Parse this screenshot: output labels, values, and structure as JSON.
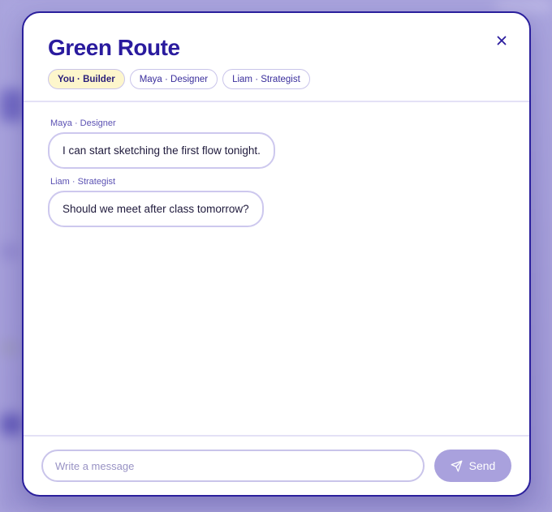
{
  "chat": {
    "title": "Green Route",
    "participants": [
      {
        "label": "You · Builder",
        "active": true
      },
      {
        "label": "Maya · Designer",
        "active": false
      },
      {
        "label": "Liam · Strategist",
        "active": false
      }
    ],
    "messages": [
      {
        "sender": "Maya · Designer",
        "text": "I can start sketching the first flow tonight."
      },
      {
        "sender": "Liam · Strategist",
        "text": "Should we meet after class tomorrow?"
      }
    ]
  },
  "composer": {
    "placeholder": "Write a message",
    "value": "",
    "send_label": "Send"
  },
  "icons": {
    "close": "close-icon",
    "send": "paper-plane-icon"
  },
  "colors": {
    "accent": "#2a1b9e",
    "active_chip_bg": "#fdf6cc",
    "send_button": "#a9a1dd",
    "backdrop": "#a9a3dc"
  }
}
